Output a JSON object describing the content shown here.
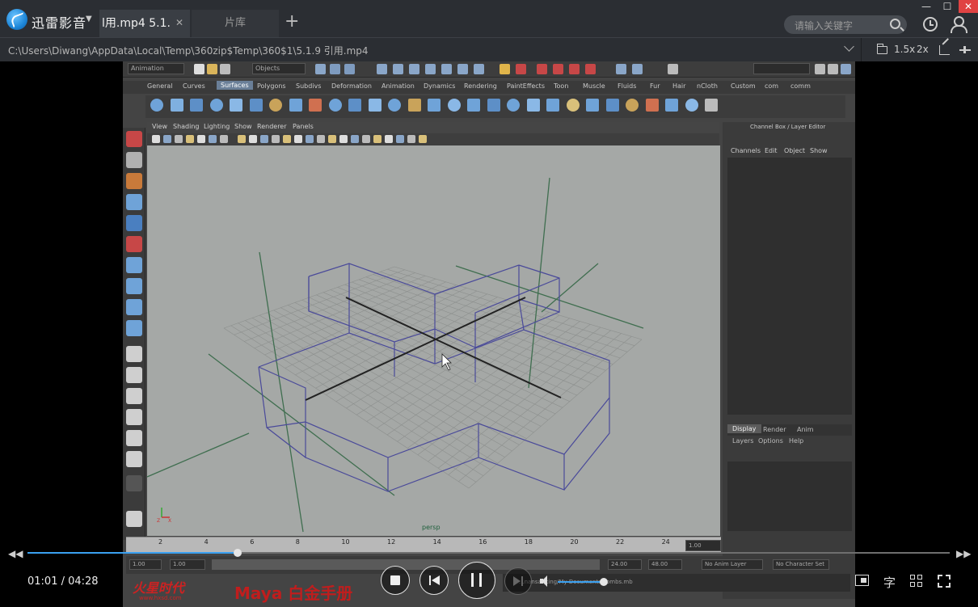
{
  "app": {
    "brand": "迅雷影音"
  },
  "tabs": {
    "active_title": "l用.mp4    5.1.",
    "library": "片库"
  },
  "search": {
    "placeholder": "请输入关键字"
  },
  "path": {
    "value": "C:\\Users\\Diwang\\AppData\\Local\\Temp\\360zip$Temp\\360$1\\5.1.9 引用.mp4"
  },
  "pathbar": {
    "speed": "1.5x",
    "zoom": "2x"
  },
  "maya": {
    "mode_dropdown": "Animation",
    "objects_field": "Objects",
    "shelf_tabs": [
      "General",
      "Curves",
      "Surfaces",
      "Polygons",
      "Subdivs",
      "Deformation",
      "Animation",
      "Dynamics",
      "Rendering",
      "PaintEffects",
      "Toon",
      "Muscle",
      "Fluids",
      "Fur",
      "Hair",
      "nCloth",
      "Custom",
      "com",
      "comm"
    ],
    "active_shelf_tab": "Surfaces",
    "viewport_menu": [
      "View",
      "Shading",
      "Lighting",
      "Show",
      "Renderer",
      "Panels"
    ],
    "viewport_label": "persp",
    "channel_box_title": "Channel Box / Layer Editor",
    "channel_menu": [
      "Channels",
      "Edit",
      "Object",
      "Show"
    ],
    "layer_tabs": [
      "Display",
      "Render",
      "Anim"
    ],
    "layer_menu": [
      "Layers",
      "Options",
      "Help"
    ],
    "timeline_ticks": [
      "2",
      "4",
      "6",
      "8",
      "10",
      "12",
      "14",
      "16",
      "18",
      "20",
      "22",
      "24"
    ],
    "current_frame": "1.00",
    "range": {
      "start": "1.00",
      "start2": "1.00",
      "end": "24.00",
      "end2": "48.00",
      "anim_layer": "No Anim Layer",
      "char_set": "No Character Set"
    },
    "command_line": "...nansanking/My Documents/combs.mb",
    "watermark": {
      "logo": "火星时代",
      "site": "www.hxsd.com",
      "title": "Maya 白金手册"
    }
  },
  "player": {
    "current_time": "01:01",
    "total_time": "04:28",
    "time_display": "01:01 / 04:28",
    "progress": 0.228,
    "volume": 0.95,
    "subtitle_label": "字"
  },
  "colors": {
    "accent": "#3aa0f0",
    "titlebar": "#2b2e33",
    "close": "#e04343",
    "wireframe": "#4a4a9a",
    "grid": "#8c8f8d",
    "axis_lines": "#3f6e4f",
    "watermark": "#c01d1d"
  }
}
